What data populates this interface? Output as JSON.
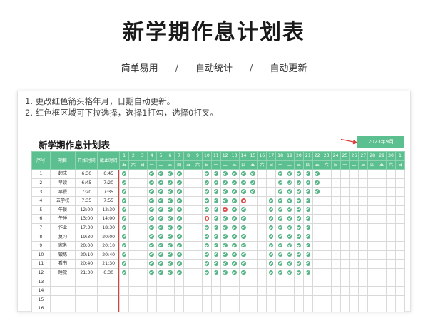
{
  "page": {
    "title": "新学期作息计划表",
    "features": [
      "简单易用",
      "自动统计",
      "自动更新"
    ],
    "separator": "/"
  },
  "notes": [
    "1. 更改红色箭头格年月，日期自动更新。",
    "2. 红色框区域可下拉选择，选择1打勾，选择0打叉。"
  ],
  "sheet": {
    "title": "新学期作息计划表",
    "month": "2023年9月",
    "headers": {
      "index": "序号",
      "activity": "项目",
      "start": "开始时间",
      "end": "截止时间"
    },
    "days": [
      "1",
      "2",
      "3",
      "4",
      "5",
      "6",
      "7",
      "8",
      "9",
      "10",
      "11",
      "12",
      "13",
      "14",
      "15",
      "16",
      "17",
      "18",
      "19",
      "20",
      "21",
      "22",
      "23",
      "24",
      "25",
      "26",
      "27",
      "28",
      "29",
      "30",
      "1"
    ],
    "weekdays": [
      "五",
      "六",
      "日",
      "一",
      "二",
      "三",
      "四",
      "五",
      "六",
      "日",
      "一",
      "二",
      "三",
      "四",
      "五",
      "六",
      "日",
      "一",
      "二",
      "三",
      "四",
      "五",
      "六",
      "日",
      "一",
      "二",
      "三",
      "四",
      "五",
      "六",
      "日"
    ],
    "rows": [
      {
        "no": "1",
        "activity": "起床",
        "start": "6:30",
        "end": "6:45",
        "marks": "1..1111..111111..11111"
      },
      {
        "no": "2",
        "activity": "早读",
        "start": "6:45",
        "end": "7:20",
        "marks": "1..1111..111111..11111"
      },
      {
        "no": "3",
        "activity": "早餐",
        "start": "7:20",
        "end": "7:35",
        "marks": "1..1111..111111..11111"
      },
      {
        "no": "4",
        "activity": "去学校",
        "start": "7:35",
        "end": "7:55",
        "marks": "1..1111..11110..11111"
      },
      {
        "no": "5",
        "activity": "午餐",
        "start": "12:00",
        "end": "12:30",
        "marks": "1..1111..11011..11111"
      },
      {
        "no": "6",
        "activity": "午睡",
        "start": "13:00",
        "end": "14:00",
        "marks": "1..1111..01111..11111"
      },
      {
        "no": "7",
        "activity": "作业",
        "start": "17:30",
        "end": "18:30",
        "marks": "1..1111..11111..11111"
      },
      {
        "no": "8",
        "activity": "复习",
        "start": "19:30",
        "end": "20:00",
        "marks": "1..1111..11111..11111"
      },
      {
        "no": "9",
        "activity": "家务",
        "start": "20:00",
        "end": "20:10",
        "marks": "1..1111..11111..11111"
      },
      {
        "no": "10",
        "activity": "锻炼",
        "start": "20:10",
        "end": "20:40",
        "marks": "1..1111..11111..11111"
      },
      {
        "no": "11",
        "activity": "看书",
        "start": "20:40",
        "end": "21:30",
        "marks": "1..1111..11111..11111"
      },
      {
        "no": "12",
        "activity": "睡觉",
        "start": "21:30",
        "end": "6:30",
        "marks": "1..1111..11111..11111"
      },
      {
        "no": "13",
        "activity": "",
        "start": "",
        "end": "",
        "marks": ""
      },
      {
        "no": "14",
        "activity": "",
        "start": "",
        "end": "",
        "marks": ""
      },
      {
        "no": "15",
        "activity": "",
        "start": "",
        "end": "",
        "marks": ""
      },
      {
        "no": "16",
        "activity": "",
        "start": "",
        "end": "",
        "marks": ""
      }
    ]
  },
  "colors": {
    "accent": "#5cbf8f",
    "check": "#57b486",
    "cross": "#e0504a",
    "frame": "#d9403a"
  }
}
